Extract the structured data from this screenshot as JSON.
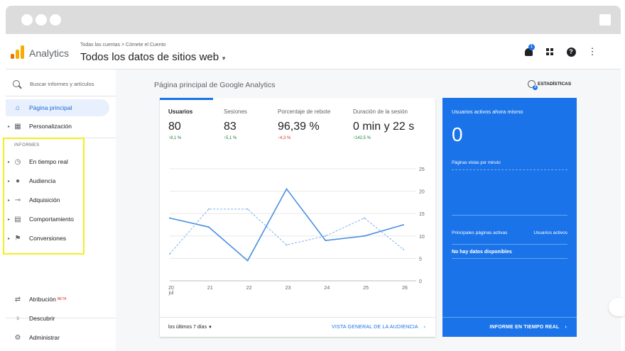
{
  "header": {
    "app_name": "Analytics",
    "breadcrumb": "Todas las cuentas > Cómete el Cuento",
    "view_title": "Todos los datos de sitios web",
    "notification_count": "1"
  },
  "colors": {
    "accent": "#1a73e8",
    "positive": "#188038",
    "negative": "#d93025",
    "highlight": "#f4ee1c",
    "logo_orange": "#f9ab00",
    "logo_dark": "#e37400"
  },
  "sidebar": {
    "search_placeholder": "Buscar informes y artículos",
    "section_label": "INFORMES",
    "items": [
      {
        "label": "Página principal",
        "icon": "home-icon"
      },
      {
        "label": "Personalización",
        "icon": "dashboard-icon"
      },
      {
        "label": "En tiempo real",
        "icon": "clock-icon"
      },
      {
        "label": "Audiencia",
        "icon": "person-icon"
      },
      {
        "label": "Adquisición",
        "icon": "acquisition-icon"
      },
      {
        "label": "Comportamiento",
        "icon": "behavior-icon"
      },
      {
        "label": "Conversiones",
        "icon": "flag-icon"
      }
    ],
    "bottom_items": [
      {
        "label": "Atribución",
        "badge": "BETA",
        "icon": "attribution-icon"
      },
      {
        "label": "Descubrir",
        "icon": "lightbulb-icon"
      },
      {
        "label": "Administrar",
        "icon": "gear-icon"
      }
    ]
  },
  "main": {
    "title": "Página principal de Google Analytics",
    "insights_label": "ESTADÍSTICAS",
    "insights_count": "3",
    "metrics": [
      {
        "label": "Usuarios",
        "value": "80",
        "change": "↑8,1 %",
        "direction": "up"
      },
      {
        "label": "Sesiones",
        "value": "83",
        "change": "↑5,1 %",
        "direction": "up"
      },
      {
        "label": "Porcentaje de rebote",
        "value": "96,39 %",
        "change": "↑4,3 %",
        "direction": "down"
      },
      {
        "label": "Duración de la sesión",
        "value": "0 min y 22 s",
        "change": "↑142,5 %",
        "direction": "up"
      }
    ],
    "period_label": "los últimos 7 días",
    "audience_link": "VISTA GENERAL DE LA AUDIENCIA"
  },
  "chart_data": {
    "type": "line",
    "x": [
      "20 jul",
      "21",
      "22",
      "23",
      "24",
      "25",
      "26"
    ],
    "series": [
      {
        "style": "solid",
        "values": [
          14,
          12,
          4.5,
          20.5,
          9,
          10,
          12.5
        ]
      },
      {
        "style": "dashed",
        "values": [
          6,
          16,
          16,
          8,
          10,
          14,
          7
        ]
      }
    ],
    "ylim": [
      0,
      25
    ],
    "yticks": [
      "0",
      "5",
      "10",
      "15",
      "20",
      "25"
    ],
    "grid": true
  },
  "realtime": {
    "title": "Usuarios activos ahora mismo",
    "value": "0",
    "pageviews_label": "Páginas vistas por minuto",
    "top_pages_label": "Principales páginas activas",
    "active_users_label": "Usuarios activos",
    "no_data": "No hay datos disponibles",
    "link": "INFORME EN TIEMPO REAL"
  }
}
